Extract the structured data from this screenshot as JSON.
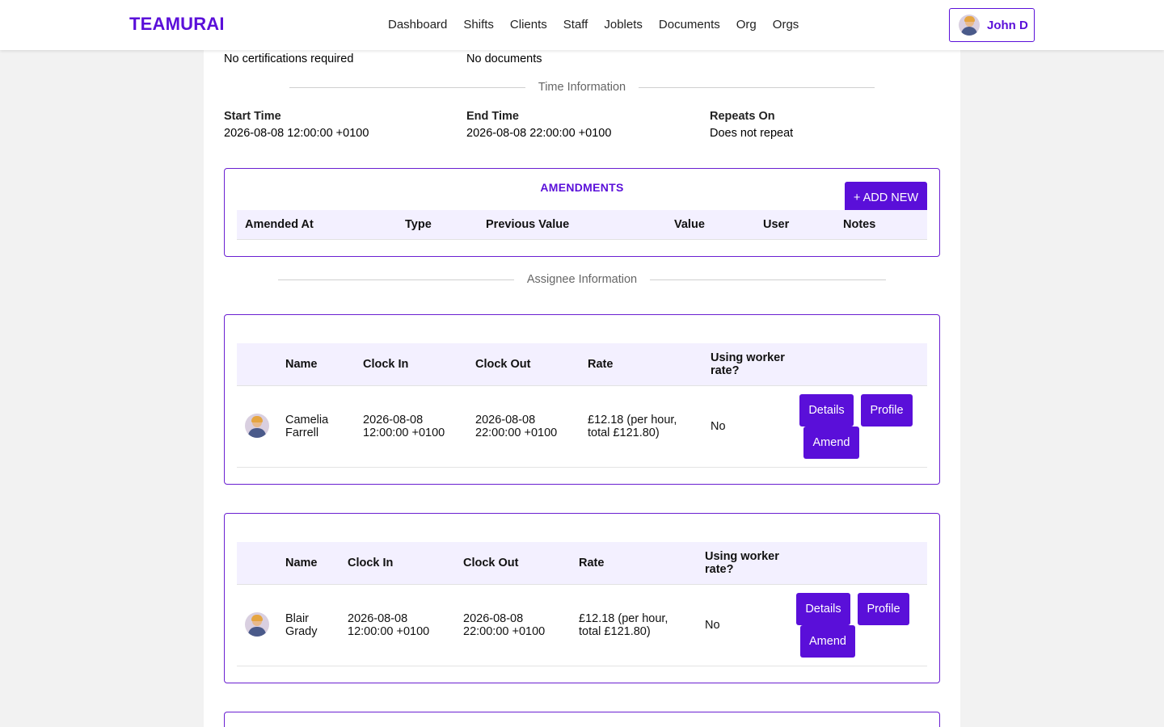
{
  "app": {
    "logo": "TEAMURAI",
    "nav": [
      "Dashboard",
      "Shifts",
      "Clients",
      "Staff",
      "Joblets",
      "Documents",
      "Org",
      "Orgs"
    ],
    "user": "John D"
  },
  "shift": {
    "certifications": "No certifications required",
    "documents": "No documents",
    "time_section": "Time Information",
    "start_time_label": "Start Time",
    "start_time": "2026-08-08 12:00:00 +0100",
    "end_time_label": "End Time",
    "end_time": "2026-08-08 22:00:00 +0100",
    "repeats_label": "Repeats On",
    "repeats": "Does not repeat"
  },
  "amendments": {
    "title": "AMENDMENTS",
    "add_button": "+ ADD NEW",
    "columns": [
      "Amended At",
      "Type",
      "Previous Value",
      "Value",
      "User",
      "Notes"
    ]
  },
  "assignee_section": "Assignee Information",
  "assignees": [
    {
      "columns": [
        "Name",
        "Clock In",
        "Clock Out",
        "Rate",
        "Using worker rate?"
      ],
      "name": "Camelia Farrell",
      "clock_in": "2026-08-08 12:00:00 +0100",
      "clock_out": "2026-08-08 22:00:00 +0100",
      "rate": "£12.18 (per hour, total £121.80)",
      "using_worker_rate": "No",
      "buttons": {
        "details": "Details",
        "profile": "Profile",
        "amend": "Amend"
      }
    },
    {
      "columns": [
        "Name",
        "Clock In",
        "Clock Out",
        "Rate",
        "Using worker rate?"
      ],
      "name": "Blair Grady",
      "clock_in": "2026-08-08 12:00:00 +0100",
      "clock_out": "2026-08-08 22:00:00 +0100",
      "rate": "£12.18 (per hour, total £121.80)",
      "using_worker_rate": "No",
      "buttons": {
        "details": "Details",
        "profile": "Profile",
        "amend": "Amend"
      }
    }
  ],
  "colors": {
    "brand": "#5a0fd9",
    "header_bg": "#f3f0ff",
    "page_bg": "#f2f2f2"
  }
}
